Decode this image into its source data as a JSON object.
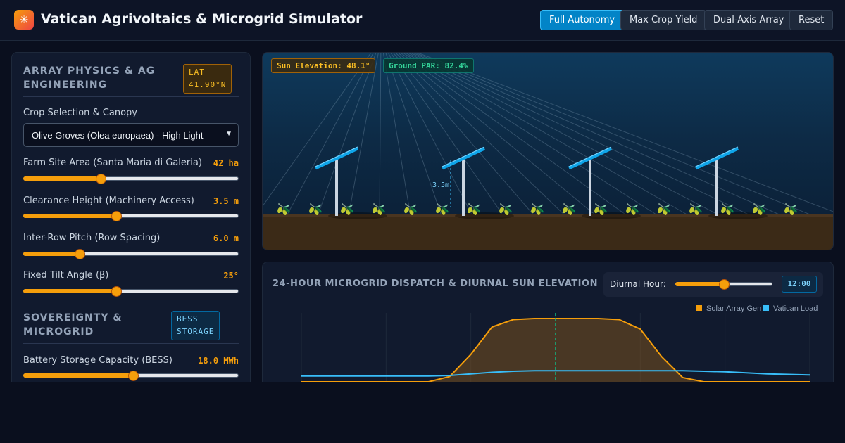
{
  "app": {
    "logo_glyph": "☀",
    "title": "Vatican Agrivoltaics & Microgrid Simulator"
  },
  "toolbar": {
    "buttons": [
      {
        "label": "Full Autonomy",
        "active": true
      },
      {
        "label": "Max Crop Yield",
        "active": false
      },
      {
        "label": "Dual-Axis Array",
        "active": false
      },
      {
        "label": "Reset",
        "active": false
      }
    ]
  },
  "physics": {
    "title_line1": "ARRAY PHYSICS & AG",
    "title_line2": "ENGINEERING",
    "tag_line1": "LAT",
    "tag_line2": "41.90°N",
    "crop_label": "Crop Selection & Canopy",
    "crop_selected": "Olive Groves (Olea europaea) - High Light",
    "fields": [
      {
        "label": "Farm Site Area (Santa Maria di Galeria)",
        "value": "42 ha",
        "level": 0.36
      },
      {
        "label": "Clearance Height (Machinery Access)",
        "value": "3.5 m",
        "level": 0.43
      },
      {
        "label": "Inter-Row Pitch (Row Spacing)",
        "value": "6.0 m",
        "level": 0.26
      },
      {
        "label": "Fixed Tilt Angle (β)",
        "value": "25°",
        "level": 0.43
      }
    ]
  },
  "microgrid": {
    "title_line1": "SOVEREIGNTY &",
    "title_line2": "MICROGRID",
    "tag_line1": "BESS",
    "tag_line2": "STORAGE",
    "fields": [
      {
        "label": "Battery Storage Capacity (BESS)",
        "value": "18.0 MWh",
        "level": 0.51
      }
    ]
  },
  "scene": {
    "sun_elevation": "Sun Elevation: 48.1°",
    "ground_par": "Ground PAR: 82.4%",
    "height_label": "3.5m",
    "plant_glyph": "🫒"
  },
  "dispatch": {
    "title": "24-HOUR MICROGRID DISPATCH & DIURNAL SUN ELEVATION",
    "hour_label": "Diurnal Hour:",
    "hour_value": "12:00",
    "hour_level": 0.5
  },
  "chart_data": {
    "type": "area",
    "x": [
      0,
      1,
      2,
      3,
      4,
      5,
      6,
      7,
      8,
      9,
      10,
      11,
      12,
      13,
      14,
      15,
      16,
      17,
      18,
      19,
      20,
      21,
      22,
      23,
      24
    ],
    "series": [
      {
        "name": "Solar Array Gen",
        "color": "#f59e0b",
        "values": [
          0,
          0,
          0,
          0,
          0,
          0,
          0,
          0.5,
          2.6,
          5.2,
          5.9,
          6.0,
          6.0,
          6.0,
          6.0,
          5.9,
          5.0,
          2.4,
          0.4,
          0,
          0,
          0,
          0,
          0,
          0
        ]
      },
      {
        "name": "Vatican Load",
        "color": "#38bdf8",
        "values": [
          0.55,
          0.55,
          0.55,
          0.55,
          0.55,
          0.55,
          0.55,
          0.6,
          0.75,
          0.9,
          1.0,
          1.05,
          1.05,
          1.05,
          1.05,
          1.05,
          1.05,
          1.05,
          1.05,
          1.0,
          0.95,
          0.85,
          0.75,
          0.7,
          0.65
        ]
      }
    ],
    "current_hour": 12,
    "grid": true,
    "legend_position": "top-right"
  }
}
